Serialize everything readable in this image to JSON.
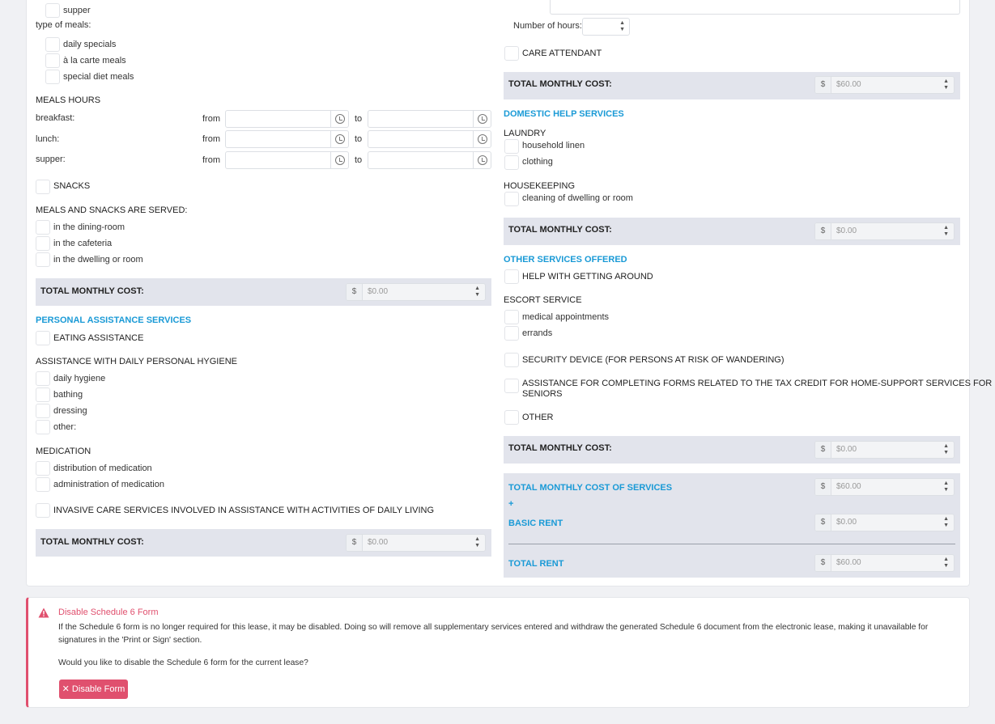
{
  "left": {
    "supper_option": "supper",
    "type_of_meals_label": "type of meals:",
    "type_of_meals": [
      "daily specials",
      "à la carte meals",
      "special diet meals"
    ],
    "meals_hours_title": "MEALS HOURS",
    "meals_rows": [
      {
        "label": "breakfast:",
        "from": "from",
        "to": "to"
      },
      {
        "label": "lunch:",
        "from": "from",
        "to": "to"
      },
      {
        "label": "supper:",
        "from": "from",
        "to": "to"
      }
    ],
    "snacks": "SNACKS",
    "served_title": "MEALS AND SNACKS ARE SERVED:",
    "served": [
      "in the dining-room",
      "in the cafeteria",
      "in the dwelling or room"
    ],
    "total1_label": "TOTAL MONTHLY COST:",
    "total1_value": "$0.00",
    "personal_title": "PERSONAL ASSISTANCE SERVICES",
    "eating": "EATING ASSISTANCE",
    "hygiene_title": "ASSISTANCE WITH DAILY PERSONAL HYGIENE",
    "hygiene": [
      "daily hygiene",
      "bathing",
      "dressing",
      "other:"
    ],
    "medication_title": "MEDICATION",
    "medication": [
      "distribution of medication",
      "administration of medication"
    ],
    "invasive": "INVASIVE CARE SERVICES INVOLVED IN ASSISTANCE WITH ACTIVITIES OF DAILY LIVING",
    "total2_label": "TOTAL MONTHLY COST:",
    "total2_value": "$0.00"
  },
  "right": {
    "hours_label": "Number of hours:",
    "care_attendant": "CARE ATTENDANT",
    "total1_label": "TOTAL MONTHLY COST:",
    "total1_value": "$60.00",
    "domestic_title": "DOMESTIC HELP SERVICES",
    "laundry_title": "LAUNDRY",
    "laundry": [
      "household linen",
      "clothing"
    ],
    "housekeeping_title": "HOUSEKEEPING",
    "housekeeping": [
      "cleaning of dwelling or room"
    ],
    "total2_label": "TOTAL MONTHLY COST:",
    "total2_value": "$0.00",
    "other_title": "OTHER SERVICES OFFERED",
    "getting_around": "HELP WITH GETTING AROUND",
    "escort_title": "ESCORT SERVICE",
    "escort": [
      "medical appointments",
      "errands"
    ],
    "security": "SECURITY DEVICE (FOR PERSONS AT RISK OF WANDERING)",
    "tax_line1": "ASSISTANCE FOR COMPLETING FORMS RELATED TO THE TAX CREDIT FOR HOME-SUPPORT SERVICES FOR",
    "tax_line2": "SENIORS",
    "other": "OTHER",
    "total3_label": "TOTAL MONTHLY COST:",
    "total3_value": "$0.00",
    "summary": {
      "services_label": "TOTAL MONTHLY COST OF SERVICES",
      "services_value": "$60.00",
      "plus": "+",
      "rent_label": "BASIC RENT",
      "rent_value": "$0.00",
      "total_label": "TOTAL RENT",
      "total_value": "$60.00"
    }
  },
  "currency_symbol": "$",
  "alert": {
    "title": "Disable Schedule 6 Form",
    "body_line1": "If the Schedule 6 form is no longer required for this lease, it may be disabled. Doing so will remove all supplementary services entered and withdraw the generated Schedule 6 document from the electronic lease, making it unavailable for",
    "body_line2": "signatures in the 'Print or Sign' section.",
    "question": "Would you like to disable the Schedule 6 form for the current lease?",
    "button": "✕ Disable Form"
  },
  "colors": {
    "accent": "#1a9ad6",
    "danger": "#e0506e",
    "bar": "#e2e4ec"
  }
}
